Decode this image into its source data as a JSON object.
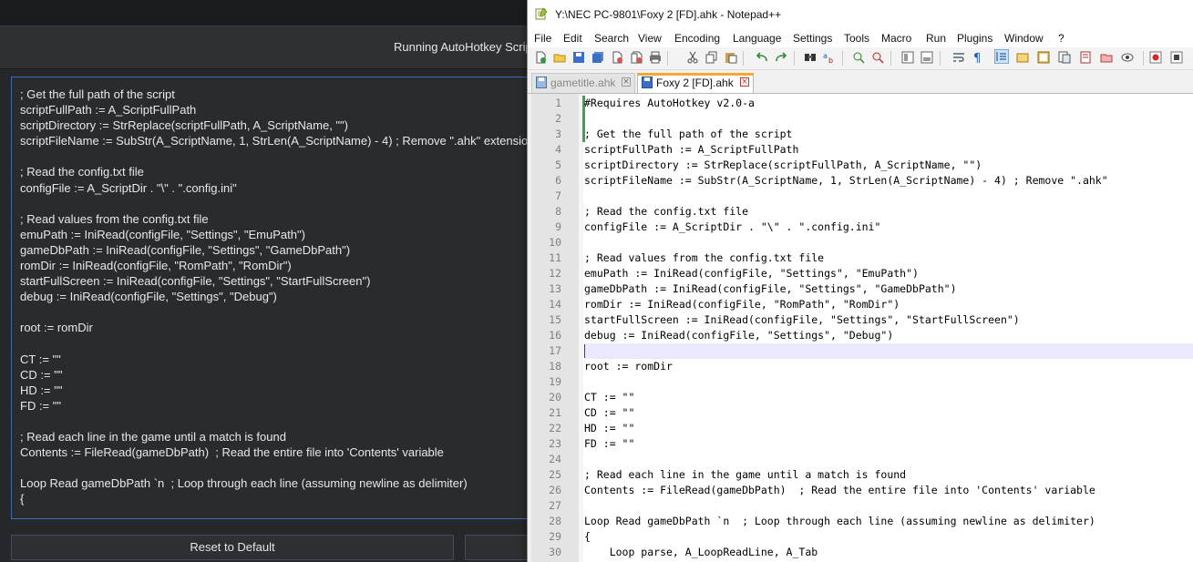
{
  "dark_app": {
    "header_title": "Running AutoHotkey Script",
    "script_lines": [
      "; Get the full path of the script",
      "scriptFullPath := A_ScriptFullPath",
      "scriptDirectory := StrReplace(scriptFullPath, A_ScriptName, \"\")",
      "scriptFileName := SubStr(A_ScriptName, 1, StrLen(A_ScriptName) - 4) ; Remove \".ahk\" extension",
      "",
      "; Read the config.txt file",
      "configFile := A_ScriptDir . \"\\\" . \".config.ini\"",
      "",
      "; Read values from the config.txt file",
      "emuPath := IniRead(configFile, \"Settings\", \"EmuPath\")",
      "gameDbPath := IniRead(configFile, \"Settings\", \"GameDbPath\")",
      "romDir := IniRead(configFile, \"RomPath\", \"RomDir\")",
      "startFullScreen := IniRead(configFile, \"Settings\", \"StartFullScreen\")",
      "debug := IniRead(configFile, \"Settings\", \"Debug\")",
      "",
      "root := romDir",
      "",
      "CT := \"\"",
      "CD := \"\"",
      "HD := \"\"",
      "FD := \"\"",
      "",
      "; Read each line in the game until a match is found",
      "Contents := FileRead(gameDbPath)  ; Read the entire file into 'Contents' variable",
      "",
      "Loop Read gameDbPath `n  ; Loop through each line (assuming newline as delimiter)",
      "{"
    ],
    "reset_button": "Reset to Default"
  },
  "npp": {
    "title": "Y:\\NEC PC-9801\\Foxy 2 [FD].ahk - Notepad++",
    "menu": [
      "File",
      "Edit",
      "Search",
      "View",
      "Encoding",
      "Language",
      "Settings",
      "Tools",
      "Macro",
      "Run",
      "Plugins",
      "Window",
      "?"
    ],
    "tabs": [
      {
        "label": "gametitle.ahk",
        "active": false
      },
      {
        "label": "Foxy 2 [FD].ahk",
        "active": true
      }
    ],
    "current_line": 17,
    "lines": [
      "#Requires AutoHotkey v2.0-a",
      "",
      "; Get the full path of the script",
      "scriptFullPath := A_ScriptFullPath",
      "scriptDirectory := StrReplace(scriptFullPath, A_ScriptName, \"\")",
      "scriptFileName := SubStr(A_ScriptName, 1, StrLen(A_ScriptName) - 4) ; Remove \".ahk\"",
      "",
      "; Read the config.txt file",
      "configFile := A_ScriptDir . \"\\\" . \".config.ini\"",
      "",
      "; Read values from the config.txt file",
      "emuPath := IniRead(configFile, \"Settings\", \"EmuPath\")",
      "gameDbPath := IniRead(configFile, \"Settings\", \"GameDbPath\")",
      "romDir := IniRead(configFile, \"RomPath\", \"RomDir\")",
      "startFullScreen := IniRead(configFile, \"Settings\", \"StartFullScreen\")",
      "debug := IniRead(configFile, \"Settings\", \"Debug\")",
      "",
      "root := romDir",
      "",
      "CT := \"\"",
      "CD := \"\"",
      "HD := \"\"",
      "FD := \"\"",
      "",
      "; Read each line in the game until a match is found",
      "Contents := FileRead(gameDbPath)  ; Read the entire file into 'Contents' variable",
      "",
      "Loop Read gameDbPath `n  ; Loop through each line (assuming newline as delimiter)",
      "{",
      "    Loop parse, A_LoopReadLine, A_Tab"
    ]
  }
}
